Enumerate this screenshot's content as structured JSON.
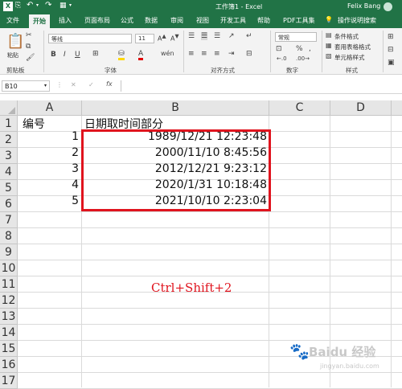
{
  "titlebar": {
    "doc": "工作簿1",
    "app": "Excel",
    "user": "Felix Bang"
  },
  "tabs": [
    "文件",
    "开始",
    "插入",
    "页面布局",
    "公式",
    "数据",
    "审阅",
    "视图",
    "开发工具",
    "帮助",
    "PDF工具集",
    "操作说明搜索"
  ],
  "ribbon": {
    "font_name": "等线",
    "font_size": "11",
    "groups": {
      "clipboard": "剪贴板",
      "font": "字体",
      "alignment": "对齐方式",
      "number": "数字",
      "styles": "样式"
    },
    "paste": "粘贴",
    "number_format": "常规",
    "style_items": [
      "条件格式",
      "套用表格格式",
      "单元格样式"
    ]
  },
  "formula_bar": {
    "name_box": "B10",
    "formula": "",
    "fx": "fx"
  },
  "sheet": {
    "columns": [
      "A",
      "B",
      "C",
      "D"
    ],
    "rows": [
      "1",
      "2",
      "3",
      "4",
      "5",
      "6",
      "7",
      "8",
      "9",
      "10",
      "11",
      "12",
      "13",
      "14",
      "15",
      "16",
      "17"
    ],
    "cells": {
      "A1": "编号",
      "B1": "日期取时间部分",
      "A2": "1",
      "B2": "1989/12/21 12:23:48",
      "A3": "2",
      "B3": "2000/11/10 8:45:56",
      "A4": "3",
      "B4": "2012/12/21 9:23:12",
      "A5": "4",
      "B5": "2020/1/31 10:18:48",
      "A6": "5",
      "B6": "2021/10/10 2:23:04"
    },
    "annotation": "Ctrl+Shift+2",
    "highlight_color": "#e0141e"
  },
  "watermark": "Baidu 经验",
  "watermark_url": "jingyan.baidu.com"
}
